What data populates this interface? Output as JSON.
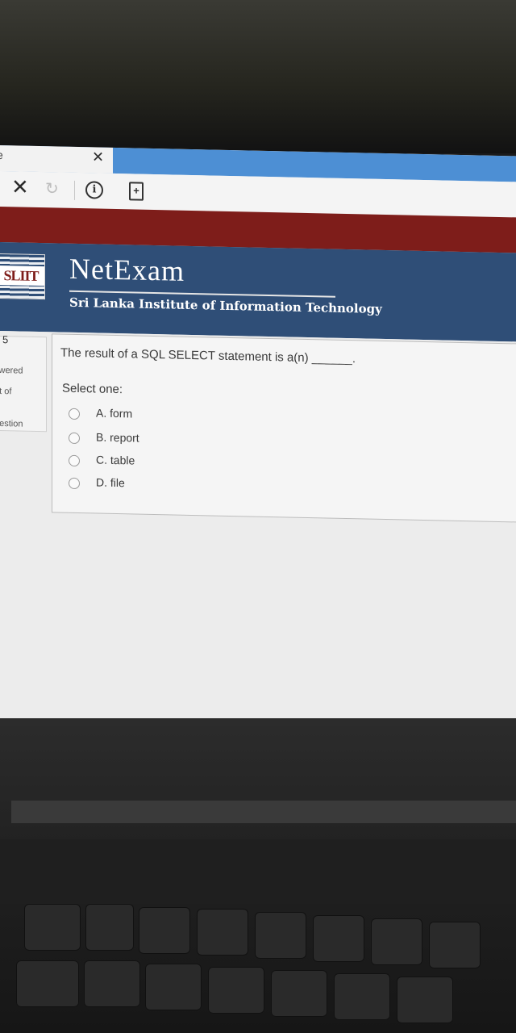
{
  "browser": {
    "tab_close_glyph": "✕",
    "tab_left_glyph": "e",
    "toolbar": {
      "close_glyph": "✕",
      "reload_glyph": "↻",
      "info_glyph": "i",
      "page_glyph": "+"
    }
  },
  "site": {
    "logo_text": "SLIIT",
    "brand_name": "NetExam",
    "institute_name": "Sri Lanka Institute of Information Technology"
  },
  "sidebar": {
    "number": "5",
    "answered_label": "swered",
    "out_of_label": "ut of",
    "question_label": "uestion"
  },
  "question": {
    "text": "The result of a SQL SELECT statement is a(n) ______.",
    "select_prompt": "Select one:",
    "options": [
      {
        "label": "A. form"
      },
      {
        "label": "B. report"
      },
      {
        "label": "C. table"
      },
      {
        "label": "D. file"
      }
    ]
  },
  "colors": {
    "tabbar": "#4d8fd4",
    "red_band": "#7e1d1a",
    "header": "#2f4e77"
  }
}
